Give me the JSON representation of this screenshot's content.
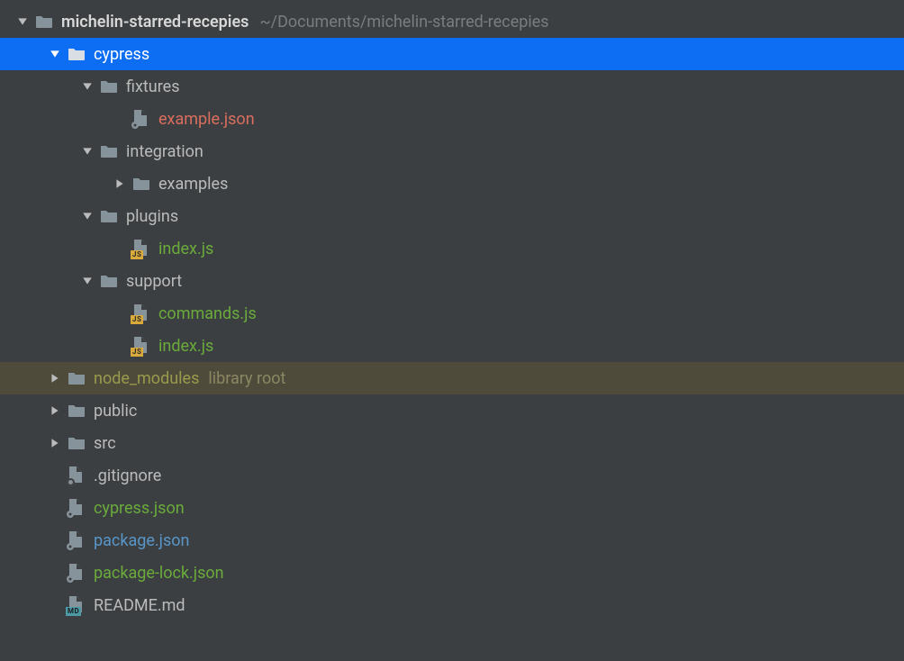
{
  "tree": {
    "root": {
      "name": "michelin-starred-recepies",
      "path_hint": "~/Documents/michelin-starred-recepies"
    },
    "cypress": {
      "name": "cypress"
    },
    "fixtures": {
      "name": "fixtures"
    },
    "example_json": {
      "name": "example.json"
    },
    "integration": {
      "name": "integration"
    },
    "examples": {
      "name": "examples"
    },
    "plugins": {
      "name": "plugins"
    },
    "plugins_index": {
      "name": "index.js"
    },
    "support": {
      "name": "support"
    },
    "commands_js": {
      "name": "commands.js"
    },
    "support_index": {
      "name": "index.js"
    },
    "node_modules": {
      "name": "node_modules",
      "hint": "library root"
    },
    "public": {
      "name": "public"
    },
    "src": {
      "name": "src"
    },
    "gitignore": {
      "name": ".gitignore"
    },
    "cypress_json": {
      "name": "cypress.json"
    },
    "package_json": {
      "name": "package.json"
    },
    "package_lock": {
      "name": "package-lock.json"
    },
    "readme": {
      "name": "README.md"
    }
  }
}
